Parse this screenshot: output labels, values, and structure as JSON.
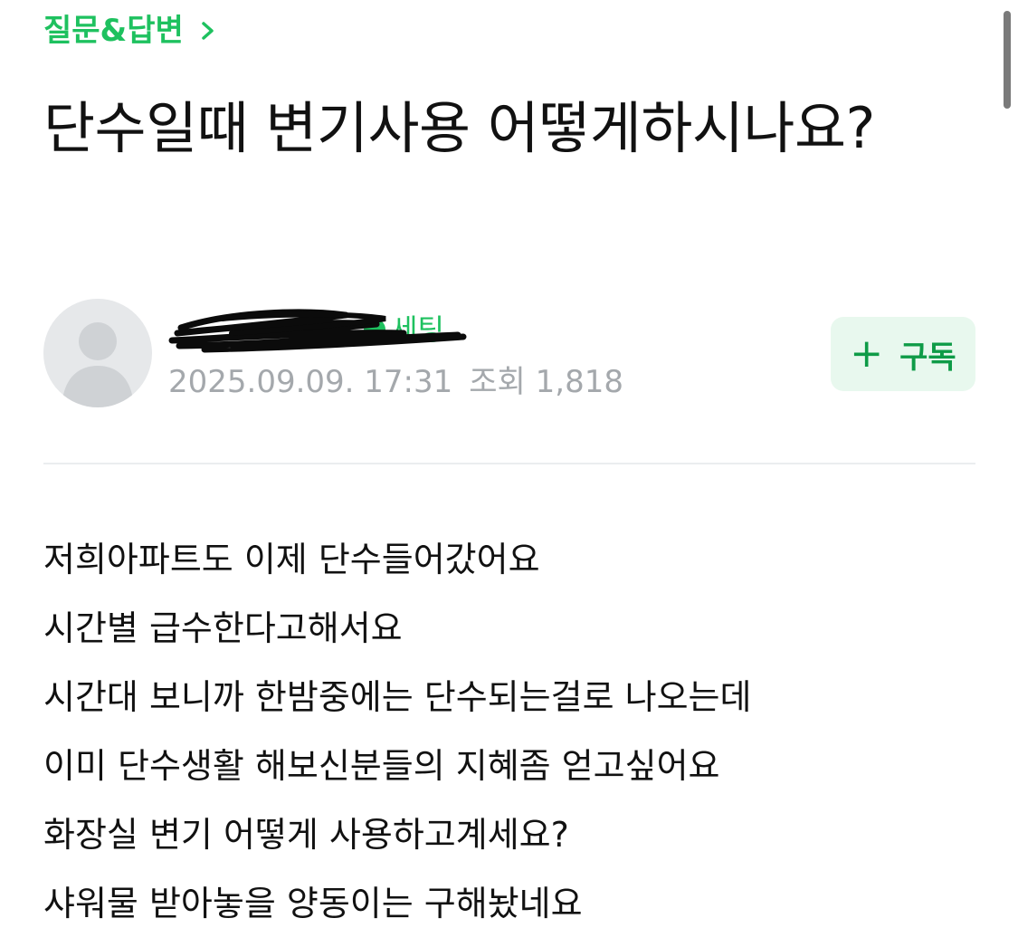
{
  "breadcrumb": {
    "label": "질문&답변",
    "icon": "chevron-right-icon",
    "color": "#1ec15f"
  },
  "post": {
    "title": "단수일때 변기사용 어떻게하시나요?",
    "author": {
      "level": "세팅",
      "avatar_icon": "default-user-avatar"
    },
    "date": "2025.09.09. 17:31",
    "views": "조회 1,818"
  },
  "subscribe": {
    "icon": "plus-icon",
    "label": "구독"
  },
  "body": {
    "lines": [
      "저희아파트도 이제 단수들어갔어요",
      "시간별 급수한다고해서요",
      "시간대 보니까 한밤중에는 단수되는걸로 나오는데",
      "이미 단수생활 해보신분들의 지혜좀 얻고싶어요",
      "화장실 변기 어떻게 사용하고계세요?",
      "샤워물 받아놓을 양동이는 구해놨네요"
    ]
  },
  "colors": {
    "accent": "#1ec15f",
    "subscribe_bg": "#e8f8ee",
    "meta_text": "#a4a8ac"
  }
}
